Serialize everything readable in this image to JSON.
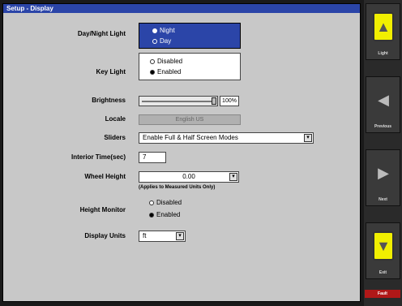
{
  "window": {
    "title": "Setup - Display"
  },
  "rows": {
    "day_night": {
      "label": "Day/Night Light",
      "options": [
        "Night",
        "Day"
      ],
      "selected": "Night"
    },
    "key_light": {
      "label": "Key Light",
      "options": [
        "Disabled",
        "Enabled"
      ],
      "selected": "Enabled"
    },
    "brightness": {
      "label": "Brightness",
      "value_text": "100%",
      "level": 1.0
    },
    "locale": {
      "label": "Locale",
      "value": "English US"
    },
    "sliders": {
      "label": "Sliders",
      "value": "Enable Full & Half Screen Modes"
    },
    "interior_time": {
      "label": "Interior Time(sec)",
      "value": "7"
    },
    "wheel_height": {
      "label": "Wheel Height",
      "value": "0.00",
      "note": "(Applies to Measured Units Only)"
    },
    "height_monitor": {
      "label": "Height Monitor",
      "options": [
        "Disabled",
        "Enabled"
      ],
      "selected": "Enabled"
    },
    "display_units": {
      "label": "Display Units",
      "value": "ft"
    }
  },
  "sidebar": {
    "buttons": [
      {
        "label": "Light",
        "icon": "up-arrow-icon",
        "style": "yellow"
      },
      {
        "label": "Previous",
        "icon": "left-arrow-icon",
        "style": "gray"
      },
      {
        "label": "Next",
        "icon": "right-arrow-icon",
        "style": "gray"
      },
      {
        "label": "Exit",
        "icon": "down-arrow-icon",
        "style": "yellow"
      }
    ],
    "status": "Fault"
  }
}
